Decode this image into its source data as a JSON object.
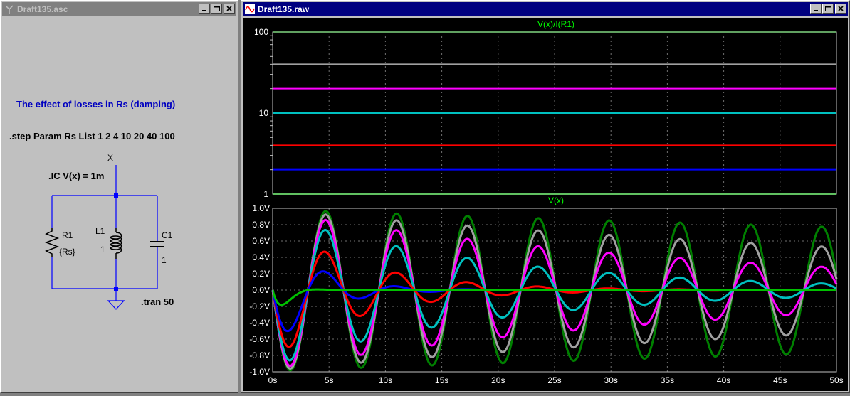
{
  "schematic_window": {
    "title": "Draft135.asc",
    "comment": "The effect of losses in Rs (damping)",
    "step_directive": ".step Param Rs List 1 2 4 10 20 40 100",
    "ic_directive": ".IC V(x) = 1m",
    "net_label": "X",
    "r1": {
      "name": "R1",
      "value": "{Rs}"
    },
    "l1": {
      "name": "L1",
      "value": "1"
    },
    "c1": {
      "name": "C1",
      "value": "1"
    },
    "tran_directive": ".tran 50"
  },
  "waveform_window": {
    "title": "Draft135.raw"
  },
  "colors": {
    "trace_rs_1": "#00c000",
    "trace_rs_2": "#0000ff",
    "trace_rs_4": "#ff0000",
    "trace_rs_10": "#00c0c0",
    "trace_rs_20": "#ff00ff",
    "trace_rs_40": "#a0a0a0",
    "trace_rs_100": "#008000",
    "schematic_wire": "#0000ff",
    "comment_text": "#0000c0"
  },
  "chart_data": [
    {
      "type": "line",
      "title": "V(x)/I(R1)",
      "y_scale": "log",
      "ylim": [
        1,
        100
      ],
      "xlim": [
        0,
        50
      ],
      "y_tick_labels": [
        "100",
        "10",
        "1"
      ],
      "grid": true,
      "series": [
        {
          "color": "#00c000",
          "values": [
            1,
            1
          ]
        },
        {
          "color": "#0000ff",
          "values": [
            2,
            2
          ]
        },
        {
          "color": "#ff0000",
          "values": [
            4,
            4
          ]
        },
        {
          "color": "#00c0c0",
          "values": [
            10,
            10
          ]
        },
        {
          "color": "#ff00ff",
          "values": [
            20,
            20
          ]
        },
        {
          "color": "#a0a0a0",
          "values": [
            40,
            40
          ]
        },
        {
          "color": "#008000",
          "values": [
            100,
            100
          ]
        }
      ]
    },
    {
      "type": "line",
      "title": "V(x)",
      "xlim": [
        0,
        50
      ],
      "ylim": [
        -1.0,
        1.0
      ],
      "x_tick_labels": [
        "0s",
        "5s",
        "10s",
        "15s",
        "20s",
        "25s",
        "30s",
        "35s",
        "40s",
        "45s",
        "50s"
      ],
      "y_tick_labels": [
        "1.0V",
        "0.8V",
        "0.6V",
        "0.4V",
        "0.2V",
        "0.0V",
        "-0.2V",
        "-0.4V",
        "-0.6V",
        "-0.8V",
        "-1.0V"
      ],
      "grid": true,
      "series": [
        {
          "rs": 1,
          "color": "#00c000",
          "amplitude": -0.56,
          "tau": 1
        },
        {
          "rs": 2,
          "color": "#0000ff",
          "amplitude": -0.72,
          "tau": 4
        },
        {
          "rs": 4,
          "color": "#ff0000",
          "amplitude": -0.84,
          "tau": 8
        },
        {
          "rs": 10,
          "color": "#00c0c0",
          "amplitude": -0.93,
          "tau": 20
        },
        {
          "rs": 20,
          "color": "#ff00ff",
          "amplitude": -0.965,
          "tau": 40
        },
        {
          "rs": 40,
          "color": "#a0a0a0",
          "amplitude": -0.98,
          "tau": 80
        },
        {
          "rs": 100,
          "color": "#008000",
          "amplitude": -0.99,
          "tau": 200
        }
      ],
      "period": 6.283
    }
  ]
}
